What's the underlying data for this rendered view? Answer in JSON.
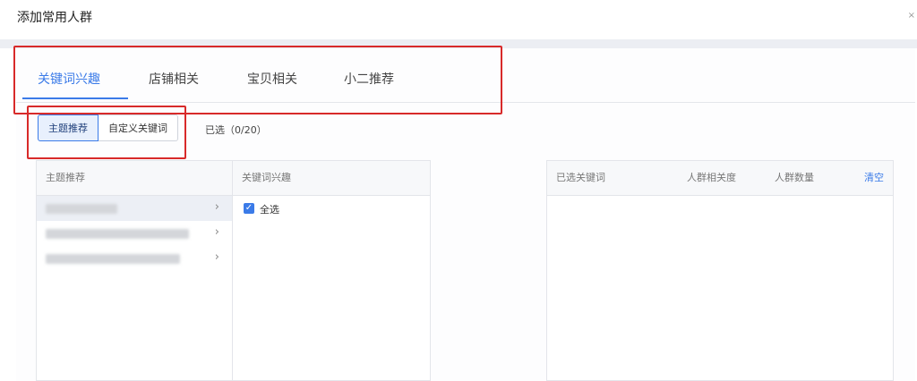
{
  "dialog": {
    "title": "添加常用人群"
  },
  "tabs": [
    {
      "label": "关键词兴趣",
      "active": true
    },
    {
      "label": "店铺相关",
      "active": false
    },
    {
      "label": "宝贝相关",
      "active": false
    },
    {
      "label": "小二推荐",
      "active": false
    }
  ],
  "segments": [
    {
      "label": "主题推荐",
      "active": true
    },
    {
      "label": "自定义关键词",
      "active": false
    }
  ],
  "selected_count": "已选（0/20）",
  "topic_column": {
    "header": "主题推荐",
    "rows": [
      {
        "active": true
      },
      {
        "active": false
      },
      {
        "active": false
      }
    ]
  },
  "keyword_column": {
    "header": "关键词兴趣",
    "select_all_label": "全选",
    "select_all_checked": true
  },
  "selected_panel": {
    "header_keywords": "已选关键词",
    "header_relevance": "人群相关度",
    "header_count": "人群数量",
    "clear_label": "清空"
  },
  "colors": {
    "accent": "#3b7be8",
    "annotation": "#d82a2a"
  }
}
